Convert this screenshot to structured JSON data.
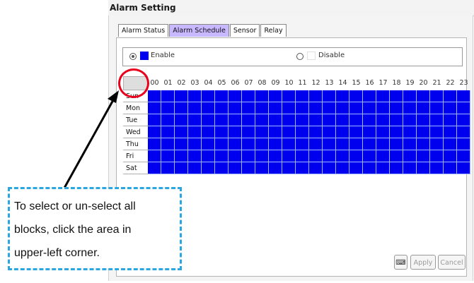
{
  "header": {
    "title": "Alarm Setting"
  },
  "tabs": [
    {
      "label": "Alarm Status",
      "active": false
    },
    {
      "label": "Alarm Schedule",
      "active": true
    },
    {
      "label": "Sensor",
      "active": false
    },
    {
      "label": "Relay",
      "active": false
    }
  ],
  "mode": {
    "enable_label": "Enable",
    "disable_label": "Disable",
    "selected": "enable",
    "enable_color": "#0000ee",
    "disable_color": "#ffffff"
  },
  "schedule": {
    "hours": [
      "00",
      "01",
      "02",
      "03",
      "04",
      "05",
      "06",
      "07",
      "08",
      "09",
      "10",
      "11",
      "12",
      "13",
      "14",
      "15",
      "16",
      "17",
      "18",
      "19",
      "20",
      "21",
      "22",
      "23"
    ],
    "days": [
      "Sun",
      "Mon",
      "Tue",
      "Wed",
      "Thu",
      "Fri",
      "Sat"
    ],
    "enabled_color": "#0000ee",
    "all_enabled": true
  },
  "buttons": {
    "apply": "Apply",
    "cancel": "Cancel",
    "keyboard_icon": "keyboard-icon"
  },
  "callout": {
    "lines": [
      "To select or un-select all",
      "blocks, click the area in",
      "upper-left corner."
    ],
    "border_color": "#2aa7e0"
  },
  "highlight_color": "#e8001c"
}
